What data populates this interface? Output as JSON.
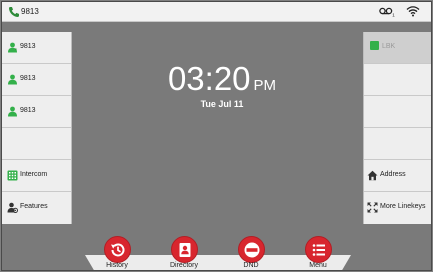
{
  "status_bar": {
    "extension": "9813",
    "icons": [
      "phone-icon",
      "voicemail-icon",
      "wifi-icon"
    ]
  },
  "left_keys": [
    {
      "label": "9813",
      "icon": "line-icon"
    },
    {
      "label": "9813",
      "icon": "line-icon"
    },
    {
      "label": "9813",
      "icon": "line-icon"
    },
    {
      "label": "",
      "icon": ""
    },
    {
      "label": "Intercom",
      "icon": "intercom-icon"
    },
    {
      "label": "Features",
      "icon": "features-icon"
    }
  ],
  "right_keys": [
    {
      "label": "LBK",
      "icon": "blf-icon",
      "selected": true
    },
    {
      "label": "",
      "icon": ""
    },
    {
      "label": "",
      "icon": ""
    },
    {
      "label": "",
      "icon": ""
    },
    {
      "label": "Address",
      "icon": "address-icon"
    },
    {
      "label": "More Linekeys",
      "icon": "more-linekeys-icon"
    }
  ],
  "clock": {
    "time": "03:20",
    "ampm": "PM",
    "date": "Tue Jul 11"
  },
  "softkeys": [
    {
      "label": "History",
      "icon": "history-icon"
    },
    {
      "label": "Directory",
      "icon": "directory-icon"
    },
    {
      "label": "DND",
      "icon": "dnd-icon"
    },
    {
      "label": "Menu",
      "icon": "menu-icon"
    }
  ],
  "colors": {
    "accent_red": "#d8262e",
    "line_green": "#33b04a",
    "background": "#7a7a7a"
  }
}
